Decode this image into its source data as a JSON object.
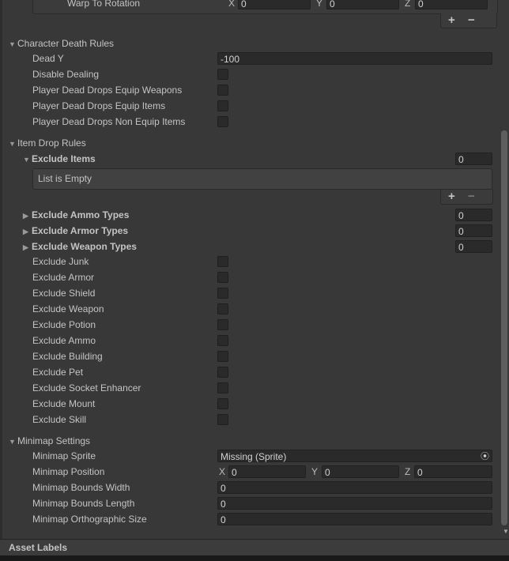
{
  "warp": {
    "label": "Warp To Rotation",
    "x_label": "X",
    "y_label": "Y",
    "z_label": "Z",
    "x": "0",
    "y": "0",
    "z": "0",
    "add": "+",
    "remove": "−"
  },
  "death": {
    "title": "Character Death Rules",
    "dead_y_label": "Dead Y",
    "dead_y": "-100",
    "checks": [
      {
        "label": "Disable Dealing",
        "checked": false
      },
      {
        "label": "Player Dead Drops Equip Weapons",
        "checked": false
      },
      {
        "label": "Player Dead Drops Equip Items",
        "checked": false
      },
      {
        "label": "Player Dead Drops Non Equip Items",
        "checked": false
      }
    ]
  },
  "item_drop": {
    "title": "Item Drop Rules",
    "exclude_items": {
      "label": "Exclude Items",
      "count": "0",
      "empty_text": "List is Empty",
      "add": "+",
      "remove": "−"
    },
    "lists": [
      {
        "label": "Exclude Ammo Types",
        "count": "0"
      },
      {
        "label": "Exclude Armor Types",
        "count": "0"
      },
      {
        "label": "Exclude Weapon Types",
        "count": "0"
      }
    ],
    "checks": [
      {
        "label": "Exclude Junk",
        "checked": false
      },
      {
        "label": "Exclude Armor",
        "checked": false
      },
      {
        "label": "Exclude Shield",
        "checked": false
      },
      {
        "label": "Exclude Weapon",
        "checked": false
      },
      {
        "label": "Exclude Potion",
        "checked": false
      },
      {
        "label": "Exclude Ammo",
        "checked": false
      },
      {
        "label": "Exclude Building",
        "checked": false
      },
      {
        "label": "Exclude Pet",
        "checked": false
      },
      {
        "label": "Exclude Socket Enhancer",
        "checked": false
      },
      {
        "label": "Exclude Mount",
        "checked": false
      },
      {
        "label": "Exclude Skill",
        "checked": false
      }
    ]
  },
  "minimap": {
    "title": "Minimap Settings",
    "sprite_label": "Minimap Sprite",
    "sprite": "Missing (Sprite)",
    "position_label": "Minimap Position",
    "x_label": "X",
    "y_label": "Y",
    "z_label": "Z",
    "x": "0",
    "y": "0",
    "z": "0",
    "bounds_width_label": "Minimap Bounds Width",
    "bounds_width": "0",
    "bounds_length_label": "Minimap Bounds Length",
    "bounds_length": "0",
    "ortho_label": "Minimap Orthographic Size",
    "ortho": "0"
  },
  "footer": {
    "asset_labels": "Asset Labels"
  }
}
